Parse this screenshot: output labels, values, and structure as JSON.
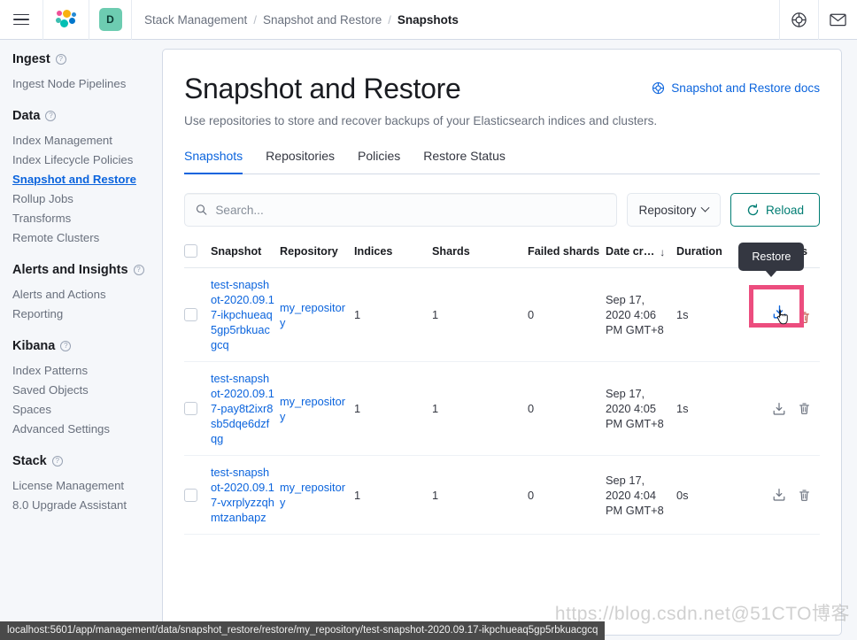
{
  "header": {
    "menu_icon": "hamburger-menu-icon",
    "logo_icon": "elastic-logo-icon",
    "space_badge": "D",
    "breadcrumbs": [
      {
        "label": "Stack Management",
        "active": false
      },
      {
        "label": "Snapshot and Restore",
        "active": false
      },
      {
        "label": "Snapshots",
        "active": true
      }
    ],
    "separator": "/",
    "right_icons": [
      "help-lifebuoy-icon",
      "mail-envelope-icon"
    ]
  },
  "sidebar": {
    "groups": [
      {
        "title": "Ingest",
        "items": [
          {
            "label": "Ingest Node Pipelines",
            "current": false
          }
        ]
      },
      {
        "title": "Data",
        "items": [
          {
            "label": "Index Management",
            "current": false
          },
          {
            "label": "Index Lifecycle Policies",
            "current": false
          },
          {
            "label": "Snapshot and Restore",
            "current": true
          },
          {
            "label": "Rollup Jobs",
            "current": false
          },
          {
            "label": "Transforms",
            "current": false
          },
          {
            "label": "Remote Clusters",
            "current": false
          }
        ]
      },
      {
        "title": "Alerts and Insights",
        "items": [
          {
            "label": "Alerts and Actions",
            "current": false
          },
          {
            "label": "Reporting",
            "current": false
          }
        ]
      },
      {
        "title": "Kibana",
        "items": [
          {
            "label": "Index Patterns",
            "current": false
          },
          {
            "label": "Saved Objects",
            "current": false
          },
          {
            "label": "Spaces",
            "current": false
          },
          {
            "label": "Advanced Settings",
            "current": false
          }
        ]
      },
      {
        "title": "Stack",
        "items": [
          {
            "label": "License Management",
            "current": false
          },
          {
            "label": "8.0 Upgrade Assistant",
            "current": false
          }
        ]
      }
    ]
  },
  "page": {
    "title": "Snapshot and Restore",
    "docs_link": "Snapshot and Restore docs",
    "docs_icon": "help-lifebuoy-icon",
    "subtitle": "Use repositories to store and recover backups of your Elasticsearch indices and clusters."
  },
  "tabs": [
    {
      "label": "Snapshots",
      "active": true
    },
    {
      "label": "Repositories",
      "active": false
    },
    {
      "label": "Policies",
      "active": false
    },
    {
      "label": "Restore Status",
      "active": false
    }
  ],
  "toolbar": {
    "search_placeholder": "Search...",
    "search_value": "",
    "search_icon": "search-icon",
    "repository_filter": "Repository",
    "repository_chevron": "chevron-down-icon",
    "reload_label": "Reload",
    "reload_icon": "refresh-icon"
  },
  "table": {
    "columns": [
      "Snapshot",
      "Repository",
      "Indices",
      "Shards",
      "Failed shards",
      "Date cr…",
      "Duration",
      "Actions"
    ],
    "sorted_column": "Date cr…",
    "sort_direction": "desc",
    "sort_arrow_glyph": "↓",
    "rows": [
      {
        "snapshot": "test-snapshot-2020.09.17-ikpchueaq5gp5rbkuacgcq",
        "repository": "my_repository",
        "indices": "1",
        "shards": "1",
        "failed_shards": "0",
        "date_created": "Sep 17, 2020 4:06 PM GMT+8",
        "duration": "1s",
        "restore_icon": "restore-download-icon",
        "delete_icon": "trash-icon",
        "highlighted": true,
        "tooltip": "Restore"
      },
      {
        "snapshot": "test-snapshot-2020.09.17-pay8t2ixr8sb5dqe6dzfqg",
        "repository": "my_repository",
        "indices": "1",
        "shards": "1",
        "failed_shards": "0",
        "date_created": "Sep 17, 2020 4:05 PM GMT+8",
        "duration": "1s",
        "restore_icon": "restore-download-icon",
        "delete_icon": "trash-icon",
        "highlighted": false,
        "tooltip": ""
      },
      {
        "snapshot": "test-snapshot-2020.09.17-vxrplyzzqhmtzanbapz",
        "repository": "my_repository",
        "indices": "1",
        "shards": "1",
        "failed_shards": "0",
        "date_created": "Sep 17, 2020 4:04 PM GMT+8",
        "duration": "0s",
        "restore_icon": "restore-download-icon",
        "delete_icon": "trash-icon",
        "highlighted": false,
        "tooltip": ""
      }
    ]
  },
  "status_bar": {
    "url": "localhost:5601/app/management/data/snapshot_restore/restore/my_repository/test-snapshot-2020.09.17-ikpchueaq5gp5rbkuacgcq"
  },
  "watermark": {
    "text": "https://blog.csdn.net@51CTO博客"
  },
  "colors": {
    "accent_blue": "#0b64dd",
    "teal": "#017d73",
    "highlight_pink": "#ec4d7e",
    "tooltip_bg": "#343741",
    "danger_red": "#bd271e"
  }
}
